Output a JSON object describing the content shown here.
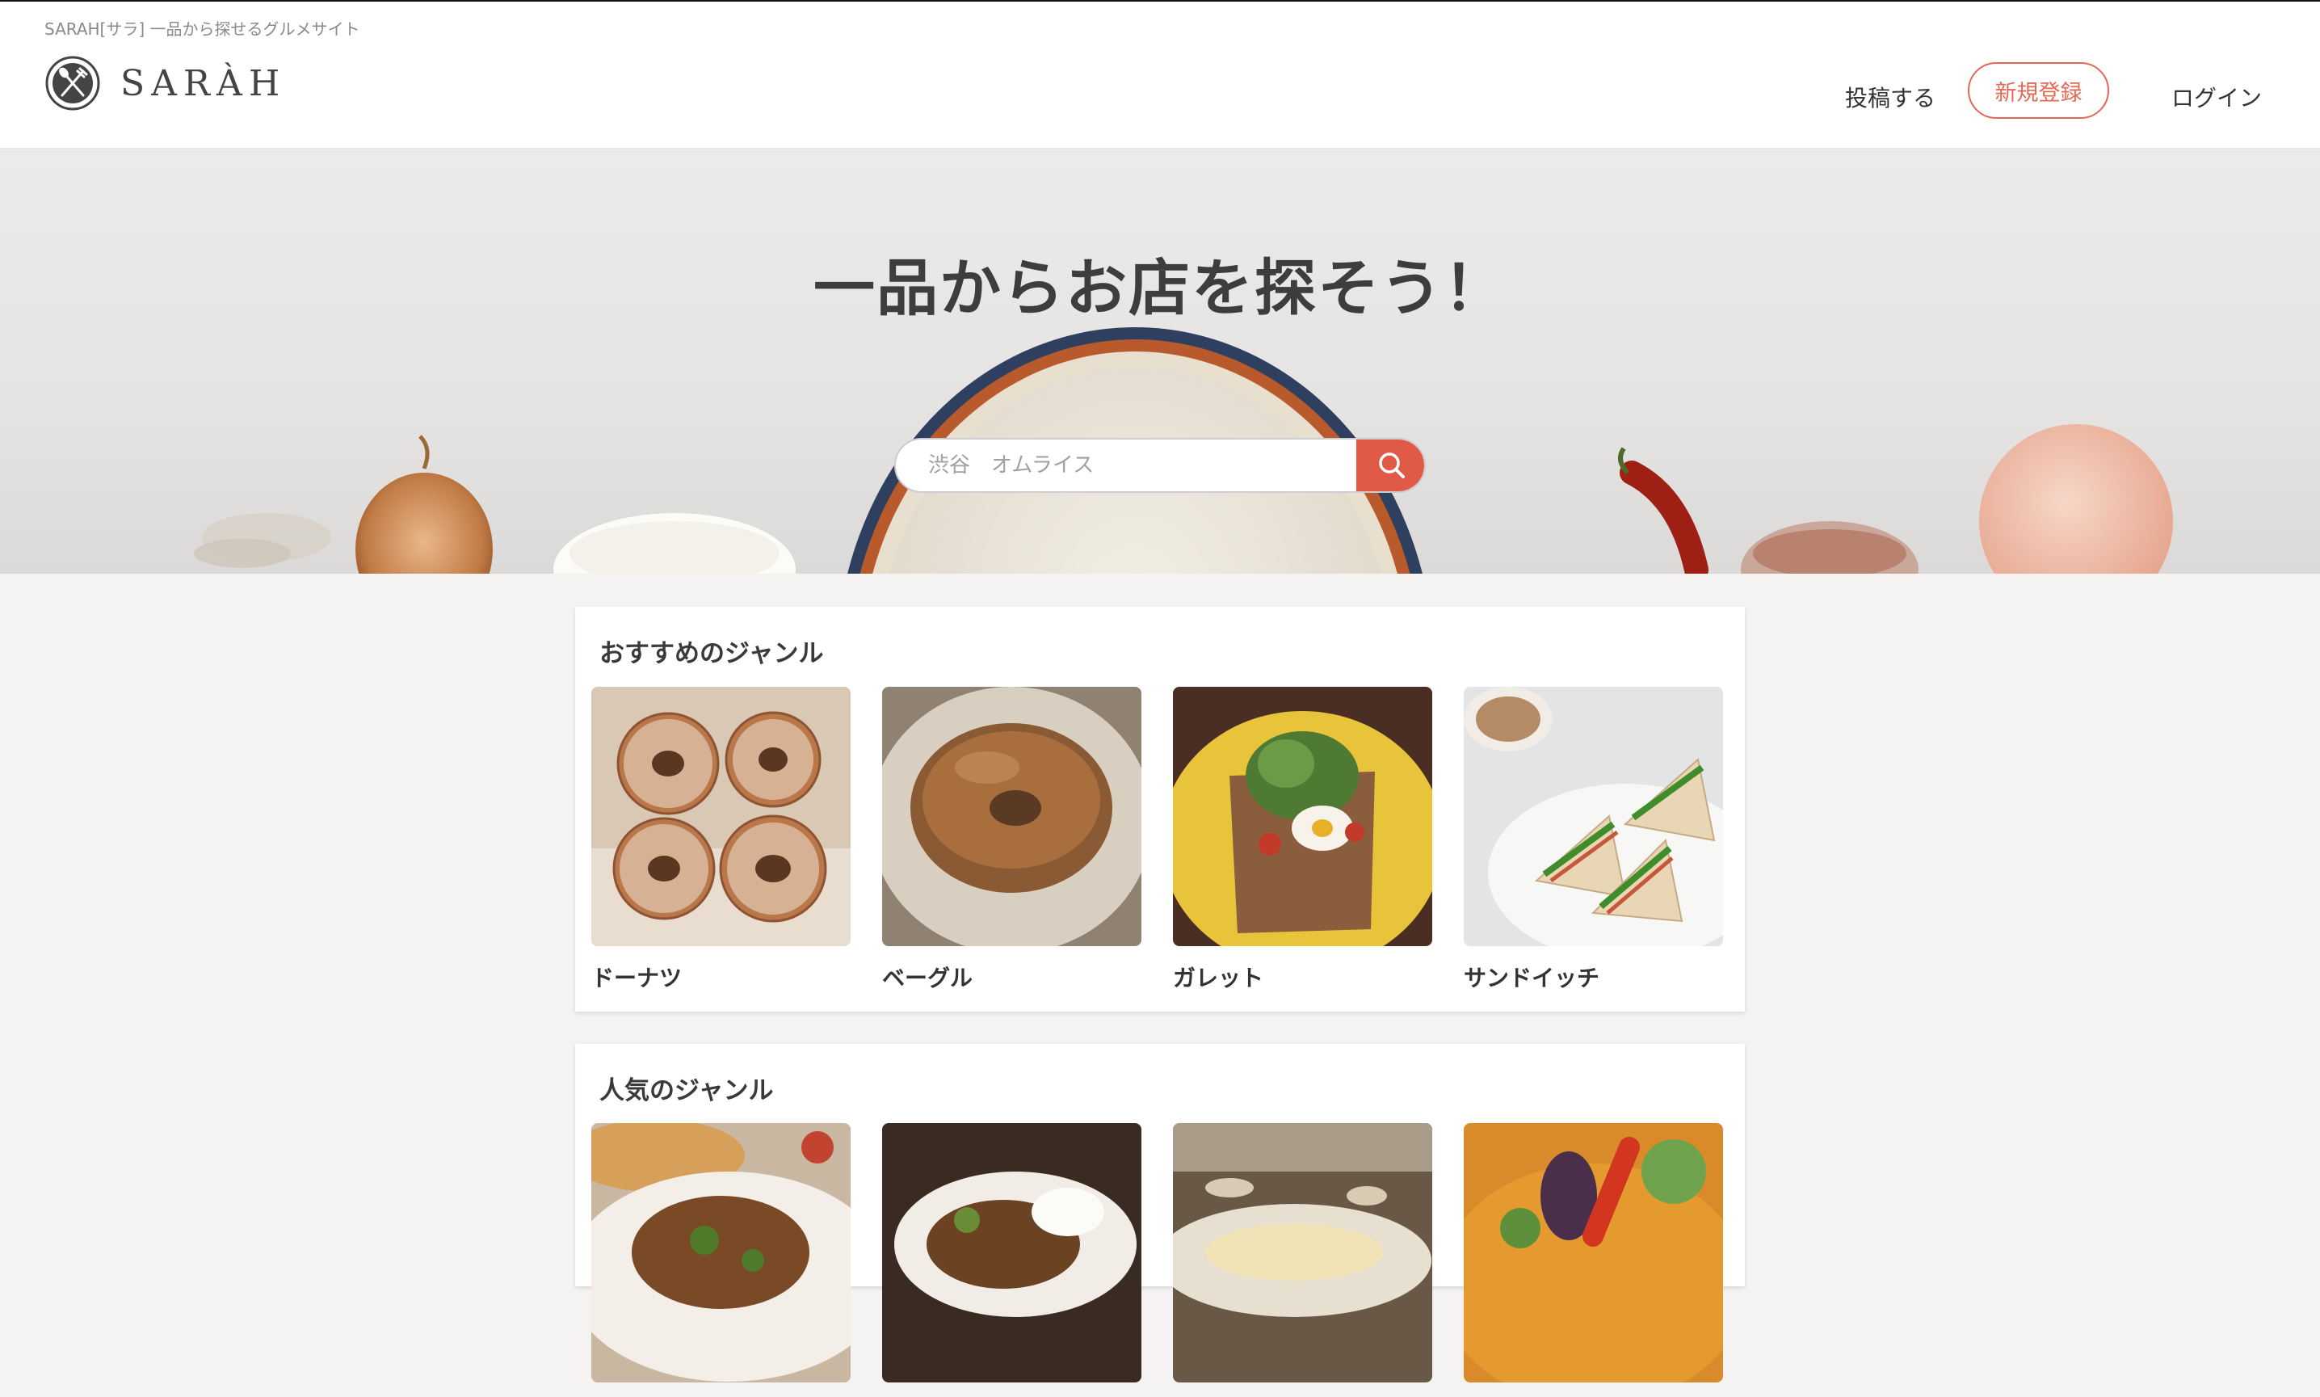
{
  "header": {
    "tagline": "SARAH[サラ] 一品から探せるグルメサイト",
    "logo_text": "SARÀH",
    "nav": {
      "post": "投稿する",
      "signup": "新規登録",
      "login": "ログイン"
    }
  },
  "hero": {
    "title": "一品からお店を探そう！",
    "search_placeholder": "渋谷　オムライス",
    "search_icon": "search-icon"
  },
  "sections": [
    {
      "title": "おすすめのジャンル",
      "items": [
        {
          "label": "ドーナツ"
        },
        {
          "label": "ベーグル"
        },
        {
          "label": "ガレット"
        },
        {
          "label": "サンドイッチ"
        }
      ]
    },
    {
      "title": "人気のジャンル",
      "items": [
        {
          "label": ""
        },
        {
          "label": ""
        },
        {
          "label": ""
        },
        {
          "label": ""
        }
      ]
    }
  ],
  "colors": {
    "accent": "#e05a48",
    "signup_border": "#e06a55",
    "background": "#f5f3f2"
  }
}
